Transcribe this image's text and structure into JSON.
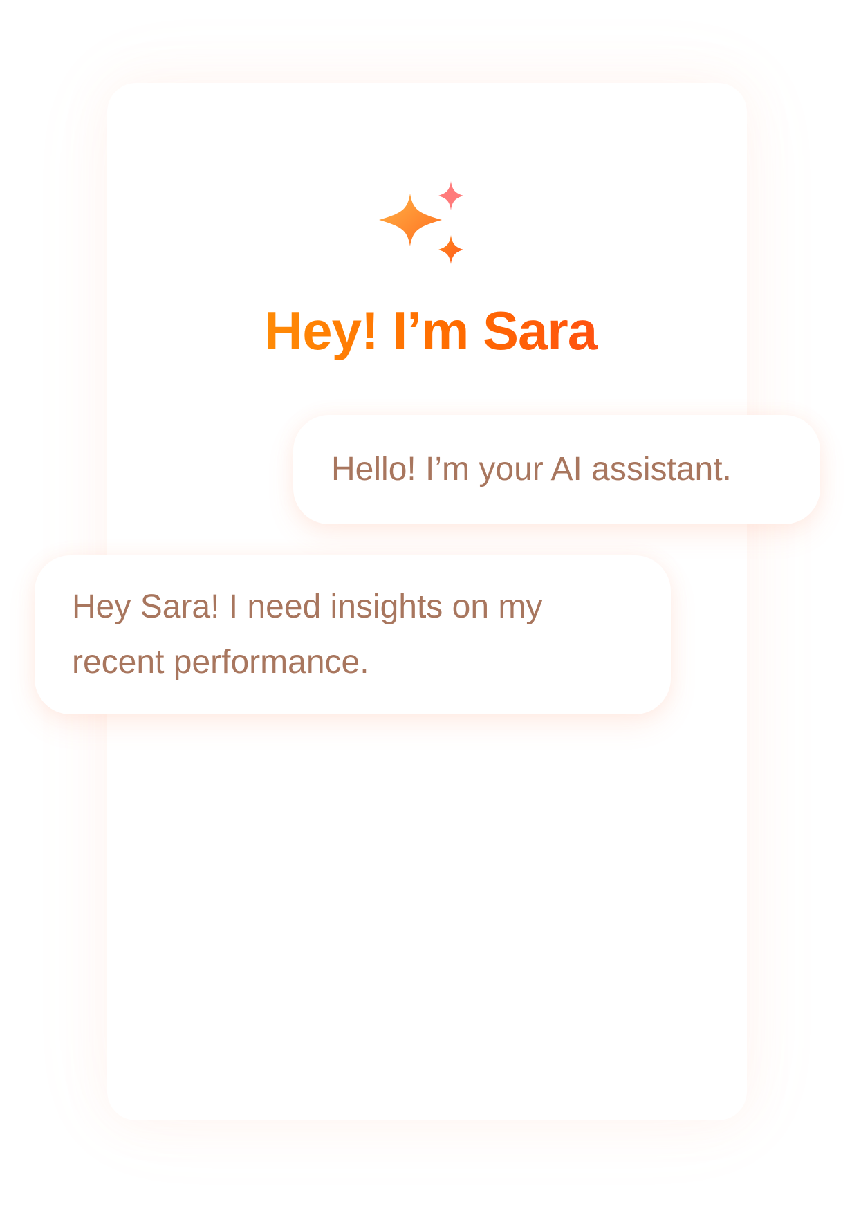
{
  "assistant": {
    "name": "Sara",
    "greeting": "Hey! I’m Sara",
    "icon": "sparkles-icon"
  },
  "chat": {
    "messages": [
      {
        "role": "assistant",
        "text": "Hello! I’m your AI assistant."
      },
      {
        "role": "user",
        "text": "Hey Sara! I need insights on my recent performance."
      }
    ]
  },
  "colors": {
    "accent_start": "#ff9f0a",
    "accent_mid": "#ff6b00",
    "accent_end": "#ff3b1f",
    "sparkle_pink": "#ff7b7b",
    "message_text": "#a8765e",
    "background": "#ffffff"
  }
}
